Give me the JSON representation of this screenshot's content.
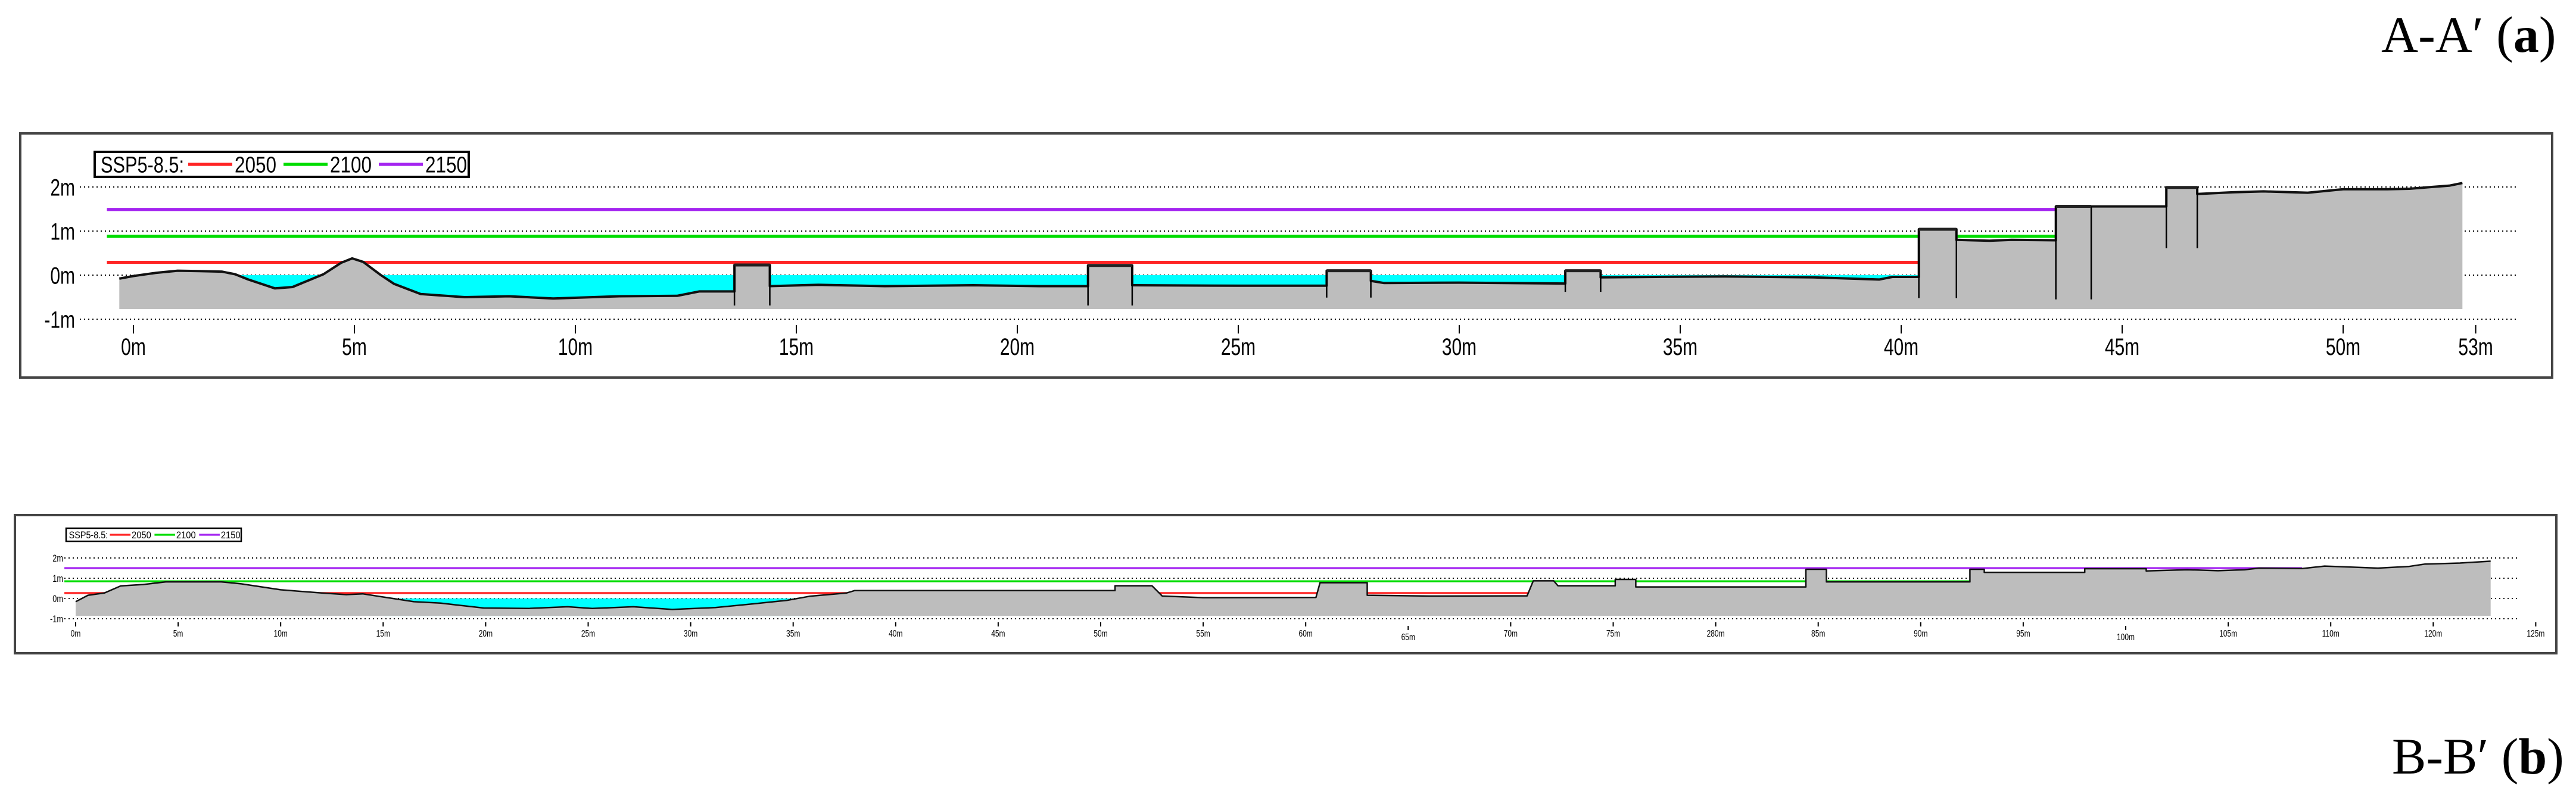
{
  "titles": {
    "a": {
      "section": "A-A′",
      "panel": "a"
    },
    "b": {
      "section": "B-B′",
      "panel": "b"
    }
  },
  "colors": {
    "ground": "#bdbdbd",
    "water": "#00ffff",
    "2050": "#ff2424",
    "2100": "#00dc00",
    "2150": "#a424f0",
    "outline": "#111111"
  },
  "chart_data": [
    {
      "id": "a",
      "type": "area",
      "title": "A-A′ (a)",
      "legend": {
        "label": "SSP5-8.5:",
        "entries": [
          "2050",
          "2100",
          "2150"
        ],
        "placement": "top-left"
      },
      "y_ticks": [
        {
          "value": 2,
          "label": "2m"
        },
        {
          "value": 1,
          "label": "1m"
        },
        {
          "value": 0,
          "label": "0m"
        },
        {
          "value": -1,
          "label": "-1m"
        }
      ],
      "x_ticks": [
        {
          "value": 0,
          "label": "0m"
        },
        {
          "value": 5,
          "label": "5m"
        },
        {
          "value": 10,
          "label": "10m"
        },
        {
          "value": 15,
          "label": "15m"
        },
        {
          "value": 20,
          "label": "20m"
        },
        {
          "value": 25,
          "label": "25m"
        },
        {
          "value": 30,
          "label": "30m"
        },
        {
          "value": 35,
          "label": "35m"
        },
        {
          "value": 40,
          "label": "40m"
        },
        {
          "value": 45,
          "label": "45m"
        },
        {
          "value": 50,
          "label": "50m"
        },
        {
          "value": 53,
          "label": "53m"
        }
      ],
      "xlim": [
        -0.6,
        54.5
      ],
      "ylim": [
        -1,
        2
      ],
      "ground_base": -0.77,
      "sea_levels": [
        {
          "scenario": "2050",
          "value": 0.29,
          "x_range": [
            -0.6,
            40.4
          ]
        },
        {
          "scenario": "2100",
          "value": 0.88,
          "x_range": [
            -0.6,
            43.5
          ]
        },
        {
          "scenario": "2150",
          "value": 1.49,
          "x_range": [
            -0.6,
            43.5
          ]
        }
      ],
      "water_range": [
        2.2,
        40.4
      ],
      "ground_profile": [
        [
          -0.32,
          -0.08
        ],
        [
          0,
          -0.02
        ],
        [
          0.5,
          0.05
        ],
        [
          1,
          0.1
        ],
        [
          1.5,
          0.09
        ],
        [
          2,
          0.08
        ],
        [
          2.3,
          0.02
        ],
        [
          2.6,
          -0.1
        ],
        [
          3.2,
          -0.3
        ],
        [
          3.6,
          -0.27
        ],
        [
          4.3,
          0.02
        ],
        [
          4.7,
          0.28
        ],
        [
          4.95,
          0.38
        ],
        [
          5.2,
          0.3
        ],
        [
          5.6,
          0.0
        ],
        [
          5.9,
          -0.2
        ],
        [
          6.5,
          -0.43
        ],
        [
          7.5,
          -0.5
        ],
        [
          8.5,
          -0.48
        ],
        [
          9.5,
          -0.53
        ],
        [
          11,
          -0.48
        ],
        [
          12.3,
          -0.47
        ],
        [
          12.8,
          -0.37
        ],
        [
          13.6,
          -0.37
        ],
        [
          13.6,
          0.23
        ],
        [
          14.4,
          0.23
        ],
        [
          14.4,
          -0.25
        ],
        [
          15.5,
          -0.22
        ],
        [
          17,
          -0.25
        ],
        [
          19,
          -0.23
        ],
        [
          20.5,
          -0.25
        ],
        [
          21.6,
          -0.25
        ],
        [
          21.6,
          0.22
        ],
        [
          22.6,
          0.22
        ],
        [
          22.6,
          -0.23
        ],
        [
          25,
          -0.24
        ],
        [
          27.0,
          -0.24
        ],
        [
          27.0,
          0.1
        ],
        [
          28.0,
          0.1
        ],
        [
          28.0,
          -0.13
        ],
        [
          28.3,
          -0.18
        ],
        [
          30,
          -0.17
        ],
        [
          32.4,
          -0.19
        ],
        [
          32.4,
          0.1
        ],
        [
          33.2,
          0.1
        ],
        [
          33.2,
          -0.05
        ],
        [
          36,
          -0.03
        ],
        [
          38,
          -0.05
        ],
        [
          39.5,
          -0.1
        ],
        [
          39.8,
          -0.04
        ],
        [
          40.4,
          -0.04
        ],
        [
          40.4,
          1.04
        ],
        [
          41.25,
          1.04
        ],
        [
          41.25,
          0.8
        ],
        [
          42,
          0.78
        ],
        [
          42.5,
          0.8
        ],
        [
          43.5,
          0.79
        ],
        [
          43.5,
          1.56
        ],
        [
          46.0,
          1.56
        ],
        [
          46.0,
          1.99
        ],
        [
          46.7,
          1.99
        ],
        [
          46.7,
          1.84
        ],
        [
          47.5,
          1.88
        ],
        [
          48.2,
          1.9
        ],
        [
          49.2,
          1.87
        ],
        [
          50,
          1.95
        ],
        [
          51,
          1.95
        ],
        [
          51.5,
          1.96
        ],
        [
          52,
          2.0
        ],
        [
          52.4,
          2.03
        ],
        [
          52.7,
          2.09
        ]
      ],
      "walls": [
        {
          "x0": 13.6,
          "x1": 14.4,
          "top": 0.23,
          "base": -0.69
        },
        {
          "x0": 21.6,
          "x1": 22.6,
          "top": 0.22,
          "base": -0.69
        },
        {
          "x0": 27.0,
          "x1": 28.0,
          "top": 0.1,
          "base": -0.51
        },
        {
          "x0": 32.4,
          "x1": 33.2,
          "top": 0.1,
          "base": -0.38
        },
        {
          "x0": 40.4,
          "x1": 41.25,
          "top": 1.04,
          "base": -0.52
        },
        {
          "x0": 43.5,
          "x1": 44.3,
          "top": 1.56,
          "base": -0.55
        },
        {
          "x0": 46.0,
          "x1": 46.7,
          "top": 1.99,
          "base": 0.61
        }
      ]
    },
    {
      "id": "b",
      "type": "area",
      "title": "B-B′ (b)",
      "legend": {
        "label": "SSP5-8.5:",
        "entries": [
          "2050",
          "2100",
          "2150"
        ],
        "placement": "top-left"
      },
      "y_ticks": [
        {
          "value": 2,
          "label": "2m"
        },
        {
          "value": 1,
          "label": "1m"
        },
        {
          "value": 0,
          "label": "0m"
        },
        {
          "value": -1,
          "label": "-1m"
        }
      ],
      "x_ticks": [
        {
          "value": 0,
          "label": "0m"
        },
        {
          "value": 5,
          "label": "5m"
        },
        {
          "value": 10,
          "label": "10m"
        },
        {
          "value": 15,
          "label": "15m"
        },
        {
          "value": 20,
          "label": "20m"
        },
        {
          "value": 25,
          "label": "25m"
        },
        {
          "value": 30,
          "label": "30m"
        },
        {
          "value": 35,
          "label": "35m"
        },
        {
          "value": 40,
          "label": "40m"
        },
        {
          "value": 45,
          "label": "45m"
        },
        {
          "value": 50,
          "label": "50m"
        },
        {
          "value": 55,
          "label": "55m"
        },
        {
          "value": 60,
          "label": "60m"
        },
        {
          "value": 65,
          "label": "65m",
          "low": true
        },
        {
          "value": 70,
          "label": "70m"
        },
        {
          "value": 75,
          "label": "75m"
        },
        {
          "value": 80,
          "label": "280m"
        },
        {
          "value": 85,
          "label": "85m"
        },
        {
          "value": 90,
          "label": "90m"
        },
        {
          "value": 95,
          "label": "95m"
        },
        {
          "value": 100,
          "label": "100m",
          "low": true
        },
        {
          "value": 105,
          "label": "105m"
        },
        {
          "value": 110,
          "label": "110m"
        },
        {
          "value": 115,
          "label": "120m"
        },
        {
          "value": 120,
          "label": "125m"
        }
      ],
      "xlim": [
        -0.55,
        119.2
      ],
      "ylim": [
        -1,
        2
      ],
      "ground_base": -0.86,
      "sea_levels": [
        {
          "scenario": "2050",
          "value": 0.27,
          "x_range": [
            -0.55,
            108.6
          ]
        },
        {
          "scenario": "2100",
          "value": 0.85,
          "x_range": [
            -0.55,
            108.6
          ]
        },
        {
          "scenario": "2150",
          "value": 1.5,
          "x_range": [
            -0.55,
            108.6
          ]
        }
      ],
      "water_range": [
        15.0,
        35.9
      ],
      "ground_profile": [
        [
          0,
          -0.16
        ],
        [
          0.6,
          0.16
        ],
        [
          1.4,
          0.27
        ],
        [
          2.2,
          0.62
        ],
        [
          3.3,
          0.69
        ],
        [
          4.4,
          0.82
        ],
        [
          7.1,
          0.82
        ],
        [
          8.1,
          0.72
        ],
        [
          10,
          0.43
        ],
        [
          12,
          0.27
        ],
        [
          13.2,
          0.19
        ],
        [
          14,
          0.23
        ],
        [
          15.1,
          0.06
        ],
        [
          16.5,
          -0.16
        ],
        [
          17.8,
          -0.23
        ],
        [
          19.9,
          -0.47
        ],
        [
          22.1,
          -0.49
        ],
        [
          24,
          -0.41
        ],
        [
          25.2,
          -0.49
        ],
        [
          27.2,
          -0.41
        ],
        [
          29.1,
          -0.54
        ],
        [
          31.2,
          -0.45
        ],
        [
          33.4,
          -0.23
        ],
        [
          34.7,
          -0.09
        ],
        [
          35.8,
          0.11
        ],
        [
          37.6,
          0.27
        ],
        [
          38,
          0.39
        ],
        [
          50.7,
          0.39
        ],
        [
          50.7,
          0.63
        ],
        [
          52.5,
          0.63
        ],
        [
          53,
          0.12
        ],
        [
          55,
          0.04
        ],
        [
          60.5,
          0.05
        ],
        [
          60.7,
          0.78
        ],
        [
          63,
          0.78
        ],
        [
          63,
          0.16
        ],
        [
          66,
          0.12
        ],
        [
          70.8,
          0.13
        ],
        [
          71.1,
          0.87
        ],
        [
          72.1,
          0.87
        ],
        [
          72.3,
          0.63
        ],
        [
          75.1,
          0.63
        ],
        [
          75.1,
          0.94
        ],
        [
          76.1,
          0.94
        ],
        [
          76.1,
          0.57
        ],
        [
          84.4,
          0.57
        ],
        [
          84.4,
          1.44
        ],
        [
          85.4,
          1.44
        ],
        [
          85.4,
          0.82
        ],
        [
          92.4,
          0.82
        ],
        [
          92.4,
          1.44
        ],
        [
          93.1,
          1.44
        ],
        [
          93.1,
          1.29
        ],
        [
          98,
          1.29
        ],
        [
          98,
          1.47
        ],
        [
          101,
          1.47
        ],
        [
          101,
          1.36
        ],
        [
          103,
          1.42
        ],
        [
          104.5,
          1.37
        ],
        [
          105.8,
          1.42
        ],
        [
          106.5,
          1.5
        ],
        [
          108.6,
          1.48
        ],
        [
          109.7,
          1.6
        ],
        [
          112.3,
          1.5
        ],
        [
          113.8,
          1.58
        ],
        [
          114.6,
          1.7
        ],
        [
          116.3,
          1.75
        ],
        [
          117.8,
          1.84
        ]
      ],
      "walls": []
    }
  ]
}
